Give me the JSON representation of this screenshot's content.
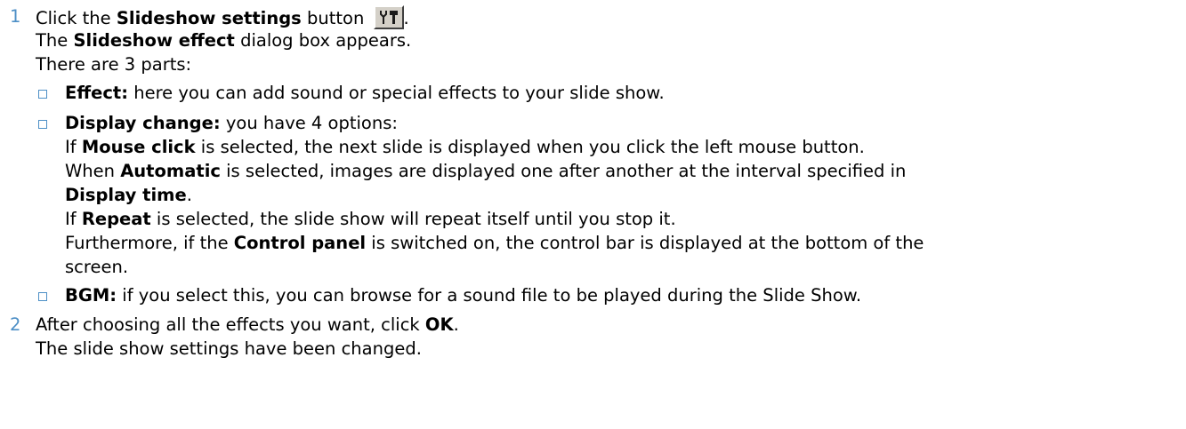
{
  "colors": {
    "accent": "#4d8fc6",
    "text": "#000000",
    "button_face": "#d4d0c8"
  },
  "step1": {
    "number": "1",
    "l1_pre": "Click the ",
    "l1_bold": "Slideshow settings",
    "l1_post": " button ",
    "l1_end": ".",
    "button_icon": "tools-icon",
    "l2_pre": "The ",
    "l2_bold": "Slideshow effect",
    "l2_post": " dialog box appears.",
    "l3": "There are 3 parts:"
  },
  "bullets": {
    "effect": {
      "bold": "Effect:",
      "text": " here you can add sound or special effects to your slide show."
    },
    "display_change": {
      "bold": "Display change:",
      "text": " you have 4 options:",
      "mouse_pre": "If ",
      "mouse_bold": "Mouse click",
      "mouse_post": " is selected, the next slide is displayed when you click the left mouse button.",
      "auto_pre": "When ",
      "auto_bold": "Automatic",
      "auto_post": " is selected, images are displayed one after another at the interval specified in",
      "display_time_bold": "Display time",
      "display_time_post": ".",
      "repeat_pre": "If ",
      "repeat_bold": "Repeat",
      "repeat_post": " is selected, the slide show will repeat itself until you stop it.",
      "control_pre": "Furthermore, if the ",
      "control_bold": "Control panel",
      "control_post": " is switched on, the control bar is displayed at the bottom of the",
      "control_end": "screen."
    },
    "bgm": {
      "bold": "BGM:",
      "text": " if you select this, you can browse for a sound file to be played during the Slide Show."
    }
  },
  "step2": {
    "number": "2",
    "l1_pre": "After choosing all the effects you want, click ",
    "l1_bold": "OK",
    "l1_post": ".",
    "l2": "The slide show settings have been changed."
  }
}
